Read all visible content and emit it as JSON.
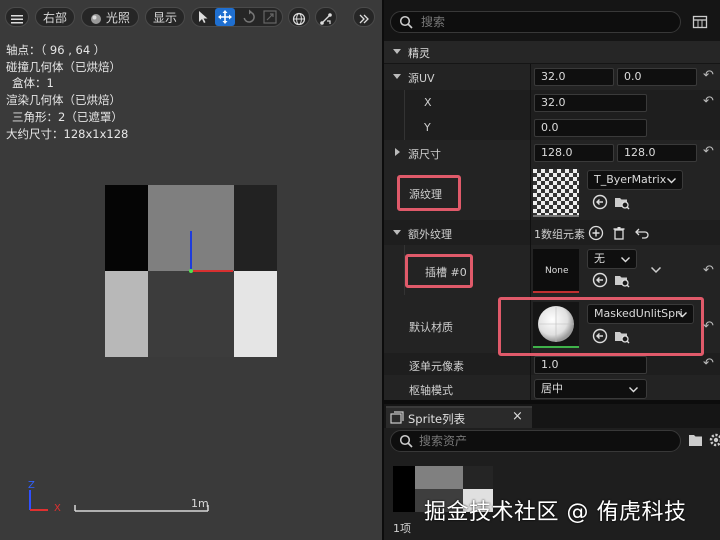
{
  "viewport": {
    "toolbar": {
      "view_label": "右部",
      "lighting_label": "光照",
      "show_label": "显示"
    },
    "overlay": {
      "pivot": "轴点：（ 96 , 64 ）",
      "collision": "碰撞几何体（已烘焙）",
      "box": "盒体：1",
      "render": "渲染几何体（已烘焙）",
      "triangles": "三角形：2（已遮罩）",
      "size": "大约尺寸：128x1x128"
    },
    "scale_label": "1m",
    "axis_z": "Z",
    "axis_x": "X"
  },
  "details": {
    "search_placeholder": "搜索",
    "category": "精灵",
    "source_uv": {
      "label": "源UV",
      "x_value": "32.0",
      "y_value": "0.0",
      "x_label": "X",
      "x_sub_value": "32.0",
      "y_label": "Y",
      "y_sub_value": "0.0"
    },
    "source_dimension": {
      "label": "源尺寸",
      "x_value": "128.0",
      "y_value": "128.0"
    },
    "source_texture": {
      "label": "源纹理",
      "asset": "T_ByerMatrix"
    },
    "additional_textures": {
      "label": "额外纹理",
      "count": "1数组元素"
    },
    "slot0": {
      "label": "插槽 #0",
      "thumb_text": "None",
      "combo_value": "无"
    },
    "default_material": {
      "label": "默认材质",
      "asset": "MaskedUnlitSpri"
    },
    "pixels_per_unit": {
      "label": "逐单元像素",
      "value": "1.0"
    },
    "pivot_mode": {
      "label": "枢轴模式",
      "value": "居中"
    }
  },
  "sprite_list": {
    "tab_label": "Sprite列表",
    "search_placeholder": "搜索资产",
    "count": "1项"
  },
  "watermark": "掘金技术社区 @ 侑虎科技",
  "colors": {
    "highlight": "#e05a6a",
    "selected_button": "#1f6fd0",
    "green_bar": "#3fb24a"
  }
}
